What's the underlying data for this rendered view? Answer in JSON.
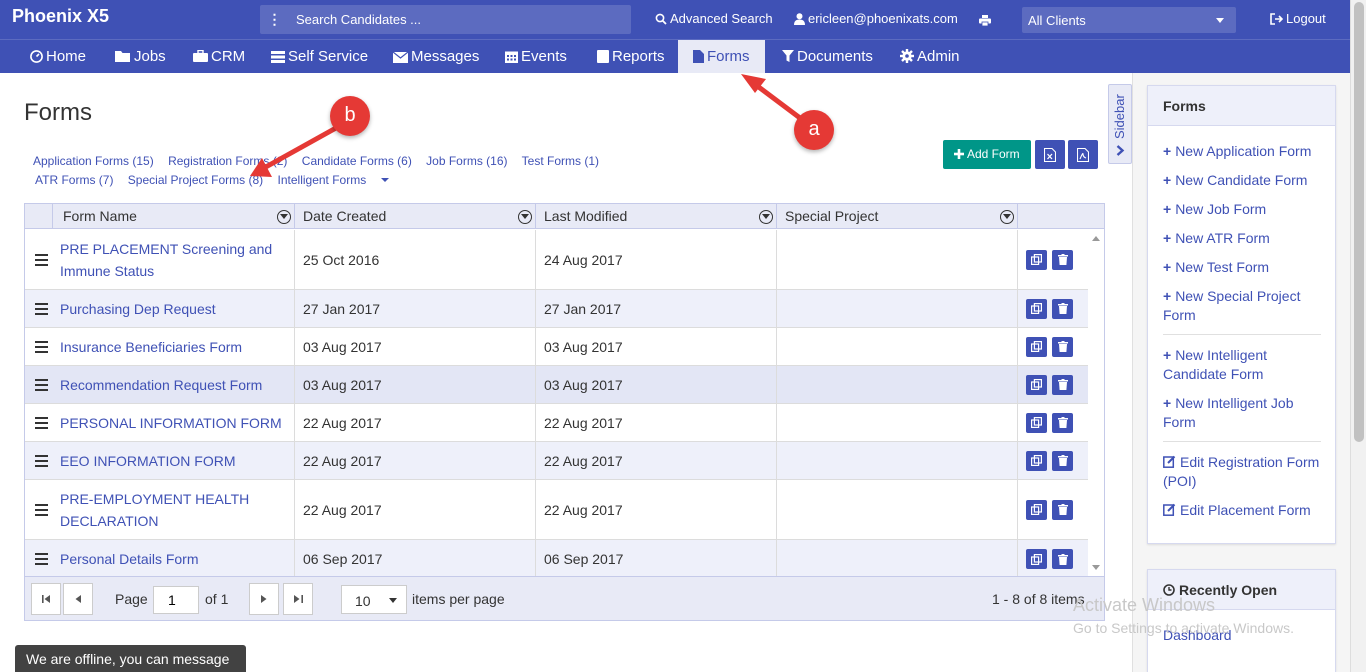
{
  "app": {
    "title": "Phoenix X5"
  },
  "header": {
    "search_placeholder": "Search Candidates ...",
    "advanced_search": "Advanced Search",
    "user_email": "ericleen@phoenixats.com",
    "client_select": "All Clients",
    "logout": "Logout"
  },
  "nav": {
    "home": "Home",
    "jobs": "Jobs",
    "crm": "CRM",
    "self_service": "Self Service",
    "messages": "Messages",
    "events": "Events",
    "reports": "Reports",
    "forms": "Forms",
    "documents": "Documents",
    "admin": "Admin"
  },
  "page": {
    "title": "Forms",
    "filters": [
      "Application Forms (15)",
      "Registration Forms (2)",
      "Candidate Forms (6)",
      "Job Forms (16)",
      "Test Forms (1)",
      "ATR Forms (7)",
      "Special Project Forms (8)",
      "Intelligent Forms"
    ],
    "add_form": "Add Form",
    "sidebar_toggle": "Sidebar"
  },
  "grid": {
    "columns": [
      "Form Name",
      "Date Created",
      "Last Modified",
      "Special Project"
    ],
    "rows": [
      {
        "name": "PRE PLACEMENT Screening and Immune Status",
        "created": "25 Oct 2016",
        "modified": "24 Aug 2017",
        "special": ""
      },
      {
        "name": "Purchasing Dep Request",
        "created": "27 Jan 2017",
        "modified": "27 Jan 2017",
        "special": ""
      },
      {
        "name": "Insurance Beneficiaries Form",
        "created": "03 Aug 2017",
        "modified": "03 Aug 2017",
        "special": ""
      },
      {
        "name": "Recommendation Request Form",
        "created": "03 Aug 2017",
        "modified": "03 Aug 2017",
        "special": ""
      },
      {
        "name": "PERSONAL INFORMATION FORM",
        "created": "22 Aug 2017",
        "modified": "22 Aug 2017",
        "special": ""
      },
      {
        "name": "EEO INFORMATION FORM",
        "created": "22 Aug 2017",
        "modified": "22 Aug 2017",
        "special": ""
      },
      {
        "name": "PRE-EMPLOYMENT HEALTH DECLARATION",
        "created": "22 Aug 2017",
        "modified": "22 Aug 2017",
        "special": ""
      },
      {
        "name": "Personal Details Form",
        "created": "06 Sep 2017",
        "modified": "06 Sep 2017",
        "special": ""
      }
    ],
    "pager": {
      "page_label": "Page",
      "page_value": "1",
      "of_label": "of 1",
      "page_size": "10",
      "per_page_label": "items per page",
      "summary": "1 - 8 of 8 items"
    }
  },
  "side_panel": {
    "title": "Forms",
    "links": [
      "New Application Form",
      "New Candidate Form",
      "New Job Form",
      "New ATR Form",
      "New Test Form",
      "New Special Project Form",
      "New Intelligent Candidate Form",
      "New Intelligent Job Form",
      "Edit Registration Form (POI)",
      "Edit Placement Form"
    ]
  },
  "recent_panel": {
    "title": "Recently Open",
    "items": [
      "Dashboard"
    ]
  },
  "watermark": {
    "line1": "Activate Windows",
    "line2": "Go to Settings to activate Windows."
  },
  "chat": {
    "offline_text": "We are offline, you can message us."
  },
  "annotations": {
    "a": "a",
    "b": "b"
  },
  "colors": {
    "primary": "#3f51b5",
    "accent": "#009688",
    "marker": "#e53935"
  }
}
